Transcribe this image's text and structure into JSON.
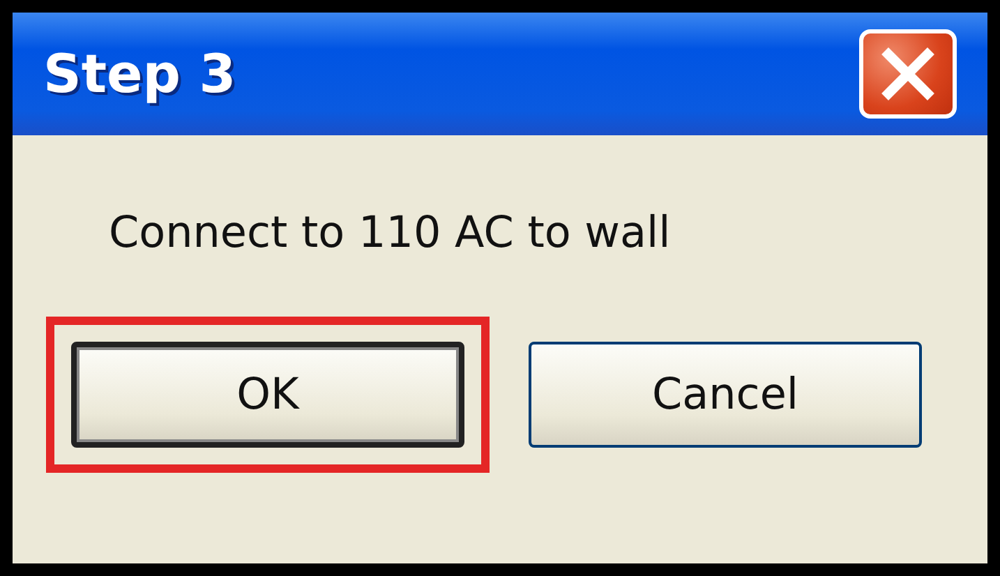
{
  "window": {
    "title": "Step 3"
  },
  "message": "Connect to 110 AC to wall",
  "buttons": [
    {
      "label": "OK",
      "default": true,
      "highlighted": true
    },
    {
      "label": "Cancel",
      "default": false,
      "highlighted": false
    }
  ]
}
